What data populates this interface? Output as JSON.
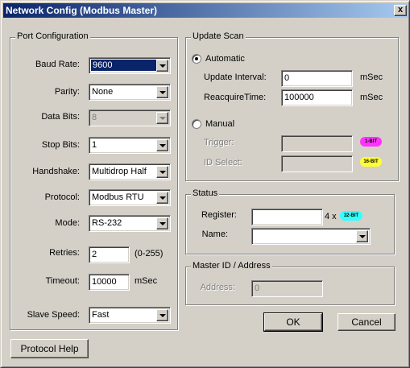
{
  "window": {
    "title": "Network Config (Modbus Master)",
    "close_label": "x"
  },
  "port": {
    "legend": "Port Configuration",
    "baud": {
      "label": "Baud Rate:",
      "value": "9600"
    },
    "parity": {
      "label": "Parity:",
      "value": "None"
    },
    "databits": {
      "label": "Data Bits:",
      "value": "8"
    },
    "stopbits": {
      "label": "Stop Bits:",
      "value": "1"
    },
    "handshake": {
      "label": "Handshake:",
      "value": "Multidrop Half"
    },
    "protocol": {
      "label": "Protocol:",
      "value": "Modbus RTU"
    },
    "mode": {
      "label": "Mode:",
      "value": "RS-232"
    },
    "retries": {
      "label": "Retries:",
      "value": "2",
      "range": "(0-255)"
    },
    "timeout": {
      "label": "Timeout:",
      "value": "10000",
      "unit": "mSec"
    },
    "slavespeed": {
      "label": "Slave Speed:",
      "value": "Fast"
    }
  },
  "scan": {
    "legend": "Update Scan",
    "automatic_label": "Automatic",
    "update_interval": {
      "label": "Update Interval:",
      "value": "0",
      "unit": "mSec"
    },
    "reacquire": {
      "label": "ReacquireTime:",
      "value": "100000",
      "unit": "mSec"
    },
    "manual_label": "Manual",
    "trigger": {
      "label": "Trigger:",
      "value": "",
      "badge": "1-BIT"
    },
    "idselect": {
      "label": "ID Select:",
      "value": "",
      "badge": "16-BIT"
    }
  },
  "status": {
    "legend": "Status",
    "register": {
      "label": "Register:",
      "value": "",
      "suffix": "4 x",
      "badge": "32-BIT"
    },
    "name": {
      "label": "Name:",
      "value": ""
    }
  },
  "master": {
    "legend": "Master ID / Address",
    "address": {
      "label": "Address:",
      "value": "0"
    }
  },
  "buttons": {
    "ok": "OK",
    "cancel": "Cancel",
    "protocol_help": "Protocol Help"
  },
  "colors": {
    "badge_1bit": "#ff33ff",
    "badge_16bit": "#ffff33",
    "badge_32bit": "#33ffff",
    "title_bar": "#0a246a"
  }
}
